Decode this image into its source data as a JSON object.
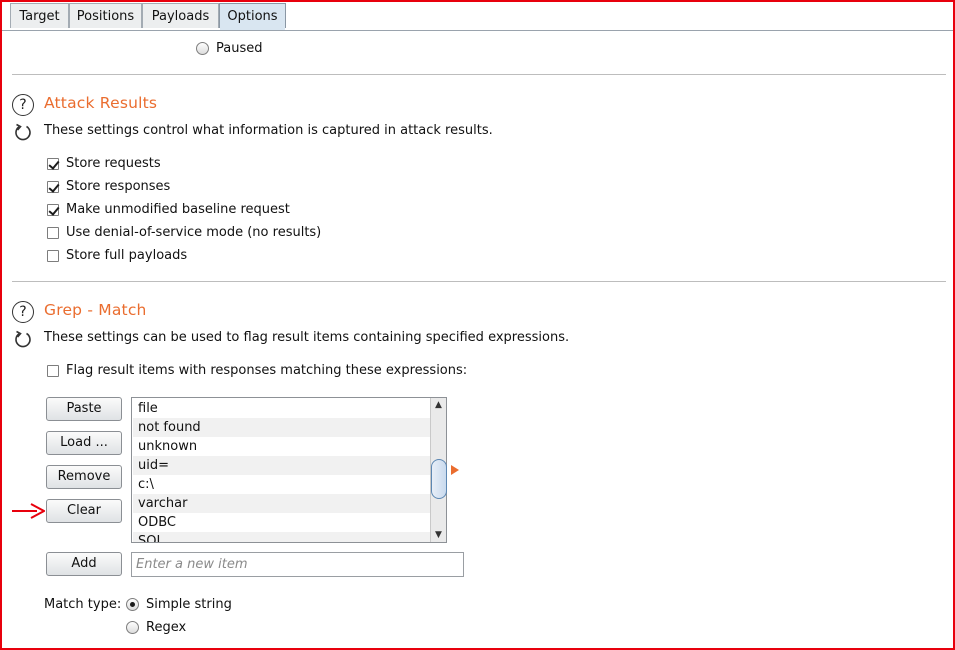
{
  "tabs": [
    "Target",
    "Positions",
    "Payloads",
    "Options"
  ],
  "active_tab": "Options",
  "paused_label": "Paused",
  "attack_results": {
    "title": "Attack Results",
    "description": "These settings control what information is captured in attack results.",
    "options": [
      {
        "label": "Store requests",
        "checked": true
      },
      {
        "label": "Store responses",
        "checked": true
      },
      {
        "label": "Make unmodified baseline request",
        "checked": true
      },
      {
        "label": "Use denial-of-service mode (no results)",
        "checked": false
      },
      {
        "label": "Store full payloads",
        "checked": false
      }
    ]
  },
  "grep_match": {
    "title": "Grep - Match",
    "description": "These settings can be used to flag result items containing specified expressions.",
    "flag_label": "Flag result items with responses matching these expressions:",
    "flag_checked": false,
    "buttons": {
      "paste": "Paste",
      "load": "Load ...",
      "remove": "Remove",
      "clear": "Clear",
      "add": "Add"
    },
    "items": [
      "file",
      "not found",
      "unknown",
      "uid=",
      "c:\\",
      "varchar",
      "ODBC",
      "SQL"
    ],
    "new_item_placeholder": "Enter a new item",
    "match_type_label": "Match type:",
    "match_types": [
      {
        "label": "Simple string",
        "selected": true
      },
      {
        "label": "Regex",
        "selected": false
      }
    ]
  },
  "colors": {
    "accent": "#ea6d2f",
    "annotation": "#e8000d",
    "active_tab": "#d9e6f1"
  },
  "icons": {
    "help": "help-icon",
    "refresh": "refresh-icon"
  }
}
